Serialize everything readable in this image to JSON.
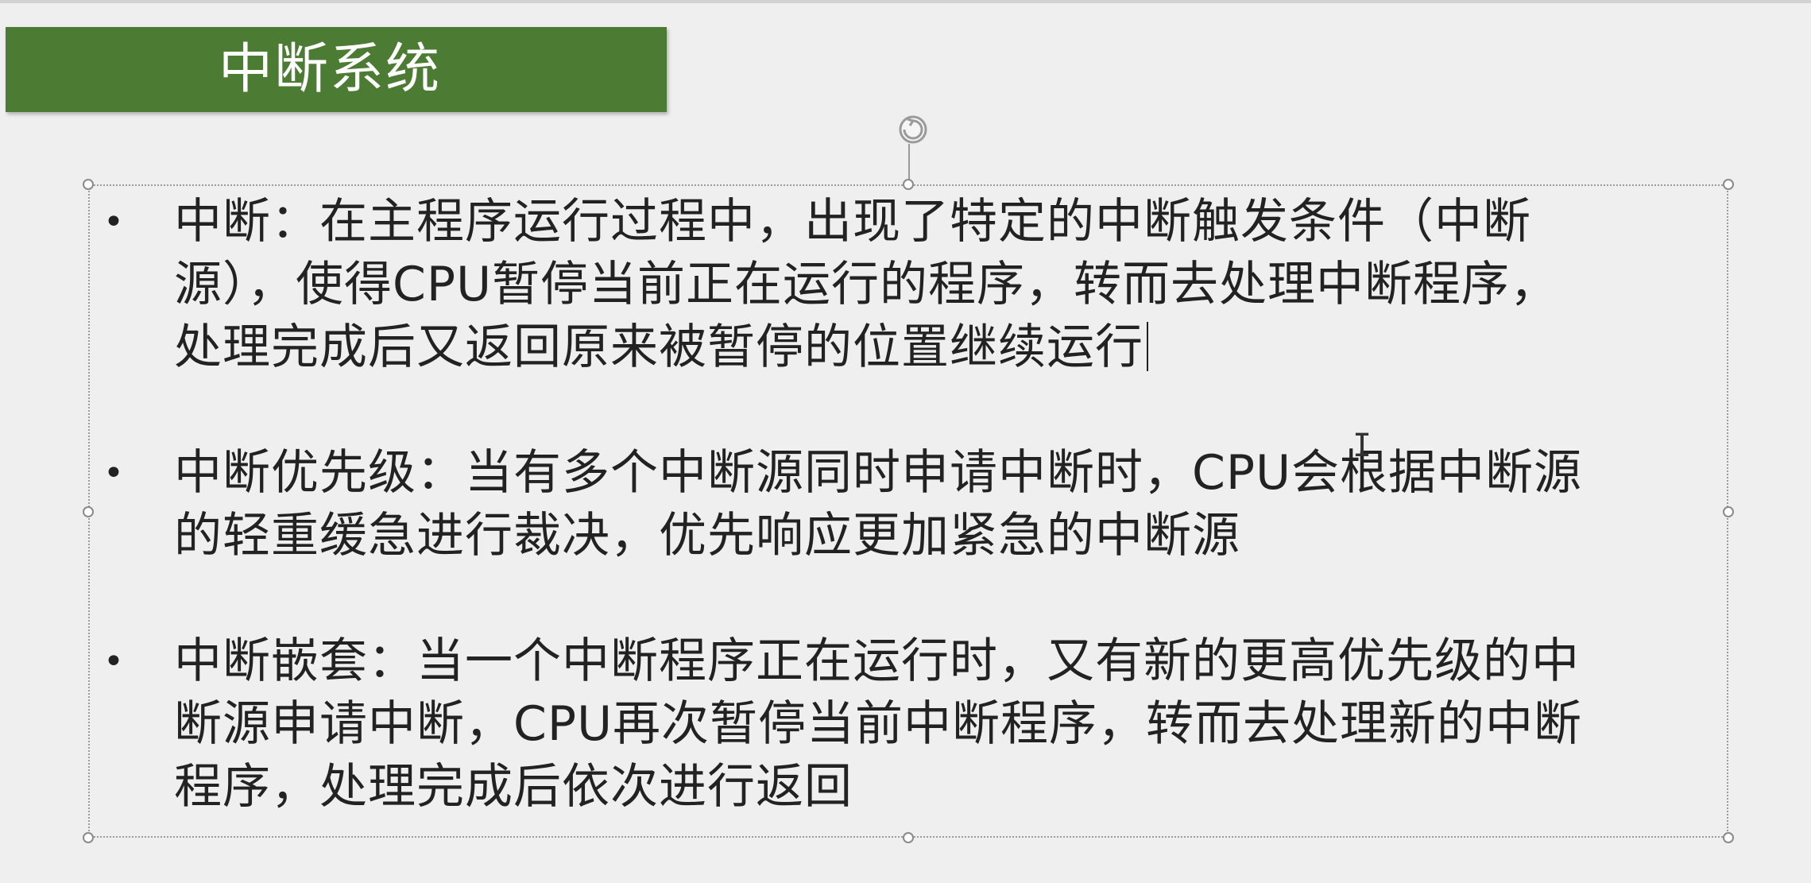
{
  "slide": {
    "title": "中断系统",
    "title_bg_color": "#4c7c33",
    "bullets": [
      {
        "marker": "•",
        "lines": [
          "中断：在主程序运行过程中，出现了特定的中断触发条件（中断",
          "源），使得CPU暂停当前正在运行的程序，转而去处理中断程序，",
          "处理完成后又返回原来被暂停的位置继续运行"
        ]
      },
      {
        "marker": "•",
        "lines": [
          "中断优先级：当有多个中断源同时申请中断时，CPU会根据中断源",
          "的轻重缓急进行裁决，优先响应更加紧急的中断源"
        ]
      },
      {
        "marker": "•",
        "lines": [
          "中断嵌套：当一个中断程序正在运行时，又有新的更高优先级的中",
          "断源申请中断，CPU再次暂停当前中断程序，转而去处理新的中断",
          "程序，处理完成后依次进行返回"
        ]
      }
    ]
  },
  "icons": {
    "rotate": "rotate-handle-icon",
    "cursor": "i-beam-cursor-icon"
  }
}
